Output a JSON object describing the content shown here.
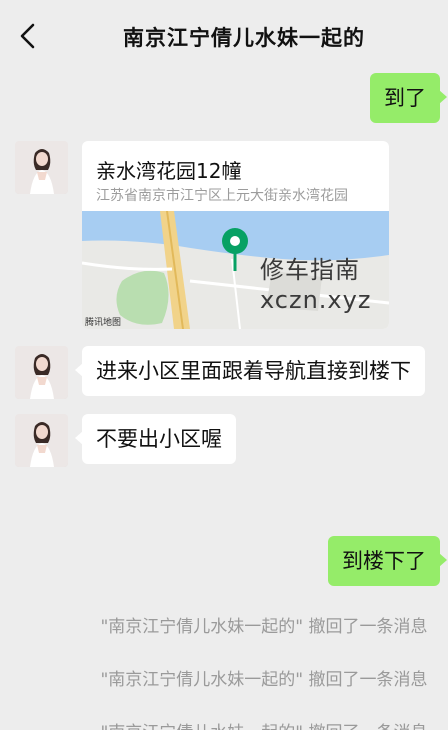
{
  "header": {
    "title": "南京江宁倩儿水妹一起的"
  },
  "messages": {
    "m1": "到了",
    "location": {
      "name": "亲水湾花园12幢",
      "address": "江苏省南京市江宁区上元大街亲水湾花园",
      "watermark_line1": "修车指南",
      "watermark_line2": "xczn.xyz",
      "map_credit": "腾讯地图"
    },
    "m3": "进来小区里面跟着导航直接到楼下",
    "m4": "不要出小区喔",
    "m5": "到楼下了"
  },
  "recalls": [
    "\"南京江宁倩儿水妹一起的\" 撤回了一条消息",
    "\"南京江宁倩儿水妹一起的\" 撤回了一条消息",
    "\"南京江宁倩儿水妹一起的\" 撤回了一条消息"
  ],
  "colors": {
    "outgoing_bubble": "#95ec69",
    "incoming_bubble": "#ffffff",
    "background": "#ededed",
    "map_pin": "#07a164"
  },
  "icons": {
    "back": "chevron-left-icon",
    "pin": "map-pin-icon"
  }
}
